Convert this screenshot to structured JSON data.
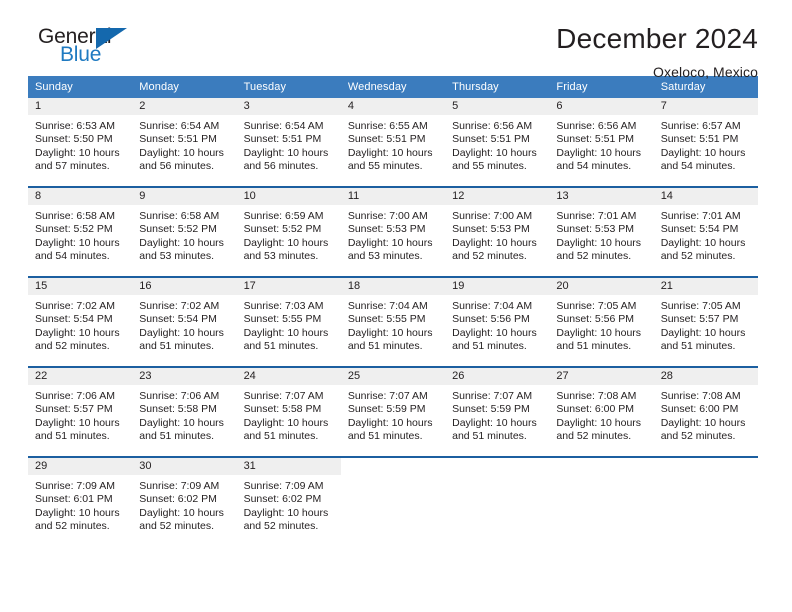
{
  "brand": {
    "line1": "General",
    "line2": "Blue",
    "triangle_icon": "brand-triangle-icon",
    "accent_color": "#1468ad"
  },
  "header": {
    "title": "December 2024",
    "subtitle": "Oxeloco, Mexico"
  },
  "theme": {
    "header_bg": "#3b7cbe",
    "row_divider": "#1c5fa0",
    "daynum_band": "#efefef",
    "text": "#231f20"
  },
  "weekday_headers": [
    "Sunday",
    "Monday",
    "Tuesday",
    "Wednesday",
    "Thursday",
    "Friday",
    "Saturday"
  ],
  "weeks": [
    [
      {
        "day": "1",
        "sunrise": "Sunrise: 6:53 AM",
        "sunset": "Sunset: 5:50 PM",
        "daylight1": "Daylight: 10 hours",
        "daylight2": "and 57 minutes."
      },
      {
        "day": "2",
        "sunrise": "Sunrise: 6:54 AM",
        "sunset": "Sunset: 5:51 PM",
        "daylight1": "Daylight: 10 hours",
        "daylight2": "and 56 minutes."
      },
      {
        "day": "3",
        "sunrise": "Sunrise: 6:54 AM",
        "sunset": "Sunset: 5:51 PM",
        "daylight1": "Daylight: 10 hours",
        "daylight2": "and 56 minutes."
      },
      {
        "day": "4",
        "sunrise": "Sunrise: 6:55 AM",
        "sunset": "Sunset: 5:51 PM",
        "daylight1": "Daylight: 10 hours",
        "daylight2": "and 55 minutes."
      },
      {
        "day": "5",
        "sunrise": "Sunrise: 6:56 AM",
        "sunset": "Sunset: 5:51 PM",
        "daylight1": "Daylight: 10 hours",
        "daylight2": "and 55 minutes."
      },
      {
        "day": "6",
        "sunrise": "Sunrise: 6:56 AM",
        "sunset": "Sunset: 5:51 PM",
        "daylight1": "Daylight: 10 hours",
        "daylight2": "and 54 minutes."
      },
      {
        "day": "7",
        "sunrise": "Sunrise: 6:57 AM",
        "sunset": "Sunset: 5:51 PM",
        "daylight1": "Daylight: 10 hours",
        "daylight2": "and 54 minutes."
      }
    ],
    [
      {
        "day": "8",
        "sunrise": "Sunrise: 6:58 AM",
        "sunset": "Sunset: 5:52 PM",
        "daylight1": "Daylight: 10 hours",
        "daylight2": "and 54 minutes."
      },
      {
        "day": "9",
        "sunrise": "Sunrise: 6:58 AM",
        "sunset": "Sunset: 5:52 PM",
        "daylight1": "Daylight: 10 hours",
        "daylight2": "and 53 minutes."
      },
      {
        "day": "10",
        "sunrise": "Sunrise: 6:59 AM",
        "sunset": "Sunset: 5:52 PM",
        "daylight1": "Daylight: 10 hours",
        "daylight2": "and 53 minutes."
      },
      {
        "day": "11",
        "sunrise": "Sunrise: 7:00 AM",
        "sunset": "Sunset: 5:53 PM",
        "daylight1": "Daylight: 10 hours",
        "daylight2": "and 53 minutes."
      },
      {
        "day": "12",
        "sunrise": "Sunrise: 7:00 AM",
        "sunset": "Sunset: 5:53 PM",
        "daylight1": "Daylight: 10 hours",
        "daylight2": "and 52 minutes."
      },
      {
        "day": "13",
        "sunrise": "Sunrise: 7:01 AM",
        "sunset": "Sunset: 5:53 PM",
        "daylight1": "Daylight: 10 hours",
        "daylight2": "and 52 minutes."
      },
      {
        "day": "14",
        "sunrise": "Sunrise: 7:01 AM",
        "sunset": "Sunset: 5:54 PM",
        "daylight1": "Daylight: 10 hours",
        "daylight2": "and 52 minutes."
      }
    ],
    [
      {
        "day": "15",
        "sunrise": "Sunrise: 7:02 AM",
        "sunset": "Sunset: 5:54 PM",
        "daylight1": "Daylight: 10 hours",
        "daylight2": "and 52 minutes."
      },
      {
        "day": "16",
        "sunrise": "Sunrise: 7:02 AM",
        "sunset": "Sunset: 5:54 PM",
        "daylight1": "Daylight: 10 hours",
        "daylight2": "and 51 minutes."
      },
      {
        "day": "17",
        "sunrise": "Sunrise: 7:03 AM",
        "sunset": "Sunset: 5:55 PM",
        "daylight1": "Daylight: 10 hours",
        "daylight2": "and 51 minutes."
      },
      {
        "day": "18",
        "sunrise": "Sunrise: 7:04 AM",
        "sunset": "Sunset: 5:55 PM",
        "daylight1": "Daylight: 10 hours",
        "daylight2": "and 51 minutes."
      },
      {
        "day": "19",
        "sunrise": "Sunrise: 7:04 AM",
        "sunset": "Sunset: 5:56 PM",
        "daylight1": "Daylight: 10 hours",
        "daylight2": "and 51 minutes."
      },
      {
        "day": "20",
        "sunrise": "Sunrise: 7:05 AM",
        "sunset": "Sunset: 5:56 PM",
        "daylight1": "Daylight: 10 hours",
        "daylight2": "and 51 minutes."
      },
      {
        "day": "21",
        "sunrise": "Sunrise: 7:05 AM",
        "sunset": "Sunset: 5:57 PM",
        "daylight1": "Daylight: 10 hours",
        "daylight2": "and 51 minutes."
      }
    ],
    [
      {
        "day": "22",
        "sunrise": "Sunrise: 7:06 AM",
        "sunset": "Sunset: 5:57 PM",
        "daylight1": "Daylight: 10 hours",
        "daylight2": "and 51 minutes."
      },
      {
        "day": "23",
        "sunrise": "Sunrise: 7:06 AM",
        "sunset": "Sunset: 5:58 PM",
        "daylight1": "Daylight: 10 hours",
        "daylight2": "and 51 minutes."
      },
      {
        "day": "24",
        "sunrise": "Sunrise: 7:07 AM",
        "sunset": "Sunset: 5:58 PM",
        "daylight1": "Daylight: 10 hours",
        "daylight2": "and 51 minutes."
      },
      {
        "day": "25",
        "sunrise": "Sunrise: 7:07 AM",
        "sunset": "Sunset: 5:59 PM",
        "daylight1": "Daylight: 10 hours",
        "daylight2": "and 51 minutes."
      },
      {
        "day": "26",
        "sunrise": "Sunrise: 7:07 AM",
        "sunset": "Sunset: 5:59 PM",
        "daylight1": "Daylight: 10 hours",
        "daylight2": "and 51 minutes."
      },
      {
        "day": "27",
        "sunrise": "Sunrise: 7:08 AM",
        "sunset": "Sunset: 6:00 PM",
        "daylight1": "Daylight: 10 hours",
        "daylight2": "and 52 minutes."
      },
      {
        "day": "28",
        "sunrise": "Sunrise: 7:08 AM",
        "sunset": "Sunset: 6:00 PM",
        "daylight1": "Daylight: 10 hours",
        "daylight2": "and 52 minutes."
      }
    ],
    [
      {
        "day": "29",
        "sunrise": "Sunrise: 7:09 AM",
        "sunset": "Sunset: 6:01 PM",
        "daylight1": "Daylight: 10 hours",
        "daylight2": "and 52 minutes."
      },
      {
        "day": "30",
        "sunrise": "Sunrise: 7:09 AM",
        "sunset": "Sunset: 6:02 PM",
        "daylight1": "Daylight: 10 hours",
        "daylight2": "and 52 minutes."
      },
      {
        "day": "31",
        "sunrise": "Sunrise: 7:09 AM",
        "sunset": "Sunset: 6:02 PM",
        "daylight1": "Daylight: 10 hours",
        "daylight2": "and 52 minutes."
      },
      {
        "day": "",
        "sunrise": "",
        "sunset": "",
        "daylight1": "",
        "daylight2": ""
      },
      {
        "day": "",
        "sunrise": "",
        "sunset": "",
        "daylight1": "",
        "daylight2": ""
      },
      {
        "day": "",
        "sunrise": "",
        "sunset": "",
        "daylight1": "",
        "daylight2": ""
      },
      {
        "day": "",
        "sunrise": "",
        "sunset": "",
        "daylight1": "",
        "daylight2": ""
      }
    ]
  ]
}
